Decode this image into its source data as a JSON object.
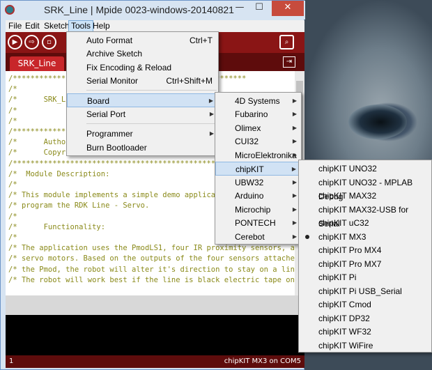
{
  "window": {
    "title": "SRK_Line | Mpide 0023-windows-20140821",
    "minimize": "—",
    "maximize": "☐",
    "close": "✕"
  },
  "menubar": {
    "file": "File",
    "edit": "Edit",
    "sketch": "Sketch",
    "tools": "Tools",
    "help": "Help"
  },
  "toolbar": {
    "verify_icon": "▶",
    "upload_icon": "⇨",
    "new_icon": "▫",
    "serial_icon": "⌕"
  },
  "tabs": {
    "active": "SRK_Line",
    "menu_icon": "⇥"
  },
  "code": [
    "/*****************************************************",
    "/*",
    "/*      SRK_Line",
    "/*",
    "/*",
    "/*****************************************************",
    "/*      Author",
    "/*      Copyr",
    "/*****************************************************",
    "/*  Module Description:",
    "/*",
    "/* This module implements a simple demo applicat",
    "/* program the RDK Line - Servo.",
    "/*",
    "/*      Functionality:",
    "/*",
    "/* The application uses the PmodLS1, four IR proximity sensors, an",
    "/* servo motors. Based on the outputs of the four sensors attached",
    "/* the Pmod, the robot will alter it's direction to stay on a line",
    "/* The robot will work best if the line is black electric tape on"
  ],
  "status": {
    "line": "1",
    "board": "chipKIT MX3 on COM5"
  },
  "tools_menu": {
    "items": [
      {
        "label": "Auto Format",
        "shortcut": "Ctrl+T"
      },
      {
        "label": "Archive Sketch",
        "shortcut": ""
      },
      {
        "label": "Fix Encoding & Reload",
        "shortcut": ""
      },
      {
        "label": "Serial Monitor",
        "shortcut": "Ctrl+Shift+M"
      },
      {
        "label": "Board",
        "shortcut": ""
      },
      {
        "label": "Serial Port",
        "shortcut": ""
      },
      {
        "label": "Programmer",
        "shortcut": ""
      },
      {
        "label": "Burn Bootloader",
        "shortcut": ""
      }
    ],
    "highlighted": "Board"
  },
  "board_menu": {
    "items": [
      "4D Systems",
      "Fubarino",
      "Olimex",
      "CUI32",
      "MicroElektronika",
      "chipKIT",
      "UBW32",
      "Arduino",
      "Microchip",
      "PONTECH",
      "Cerebot"
    ],
    "highlighted": "chipKIT"
  },
  "chipkit_menu": {
    "items": [
      "chipKIT UNO32",
      "chipKIT UNO32 - MPLAB Debug",
      "chipKIT MAX32",
      "chipKIT MAX32-USB for Serial",
      "chipKIT uC32",
      "chipKIT MX3",
      "chipKIT Pro MX4",
      "chipKIT Pro MX7",
      "chipKIT Pi",
      "chipKIT Pi USB_Serial",
      "chipKIT Cmod",
      "chipKIT DP32",
      "chipKIT WF32",
      "chipKIT WiFire"
    ],
    "selected": "chipKIT MX3"
  },
  "colors": {
    "toolbar": "#8a1515",
    "tab": "#c8262a",
    "menu_highlight": "#d1e2f4",
    "code_comment": "#8a8a1a"
  }
}
